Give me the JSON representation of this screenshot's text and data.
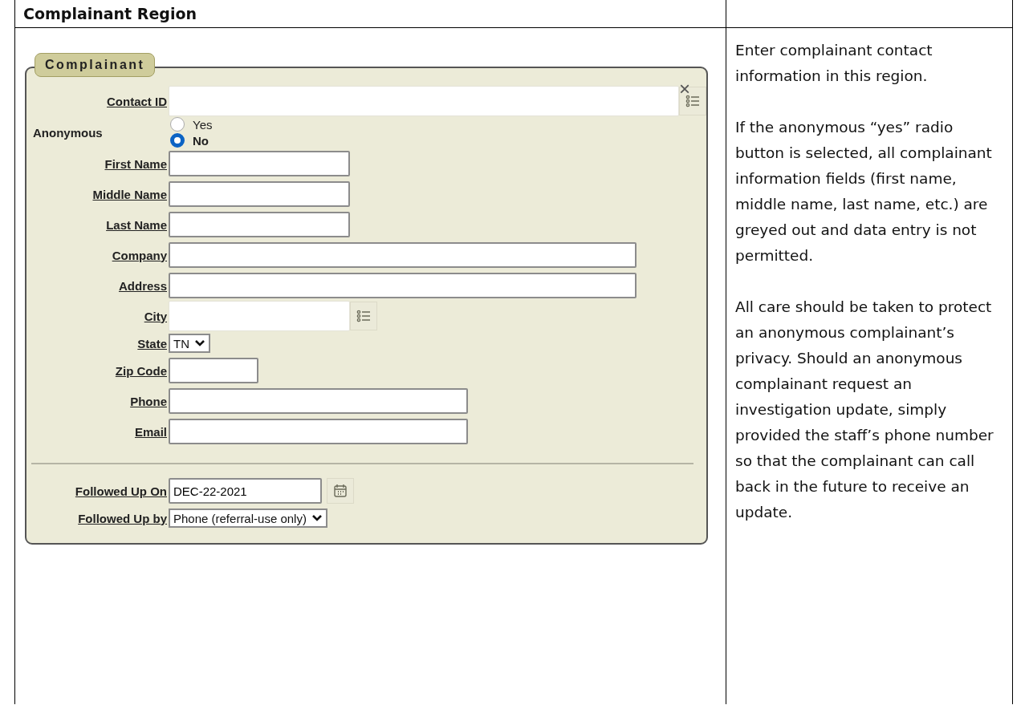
{
  "header": {
    "title": "Complainant Region"
  },
  "panel": {
    "legend": "Complainant",
    "close": "×"
  },
  "contact_fields": [
    {
      "kind": "lookup",
      "label": "Contact ID"
    },
    {
      "kind": "radio",
      "label": "Anonymous",
      "options": [
        {
          "label": "Yes",
          "selected": false
        },
        {
          "label": "No",
          "selected": true
        }
      ]
    },
    {
      "kind": "text",
      "label": "First Name"
    },
    {
      "kind": "text",
      "label": "Middle Name"
    },
    {
      "kind": "text",
      "label": "Last Name"
    },
    {
      "kind": "text",
      "label": "Company"
    },
    {
      "kind": "text",
      "label": "Address"
    },
    {
      "kind": "lookup",
      "label": "City"
    },
    {
      "kind": "select",
      "label": "State",
      "value": "TN"
    },
    {
      "kind": "text",
      "label": "Zip Code"
    },
    {
      "kind": "text",
      "label": "Phone"
    },
    {
      "kind": "text",
      "label": "Email"
    }
  ],
  "follow_up_fields": [
    {
      "kind": "date",
      "label": "Followed Up On",
      "value": "DEC-22-2021"
    },
    {
      "kind": "select",
      "label": "Followed Up by",
      "value": "Phone (referral-use only)"
    }
  ],
  "notes": [
    "Enter complainant contact information in this region.",
    "If the anonymous “yes” radio button is selected, all complainant information fields (first name, middle name, last name, etc.) are greyed out and data entry is not permitted.",
    "All care should be taken to protect an anonymous complainant’s privacy. Should an anonymous complainant request an investigation update, simply provided the staff’s phone number so that the complainant can call back in the future to receive an update."
  ]
}
